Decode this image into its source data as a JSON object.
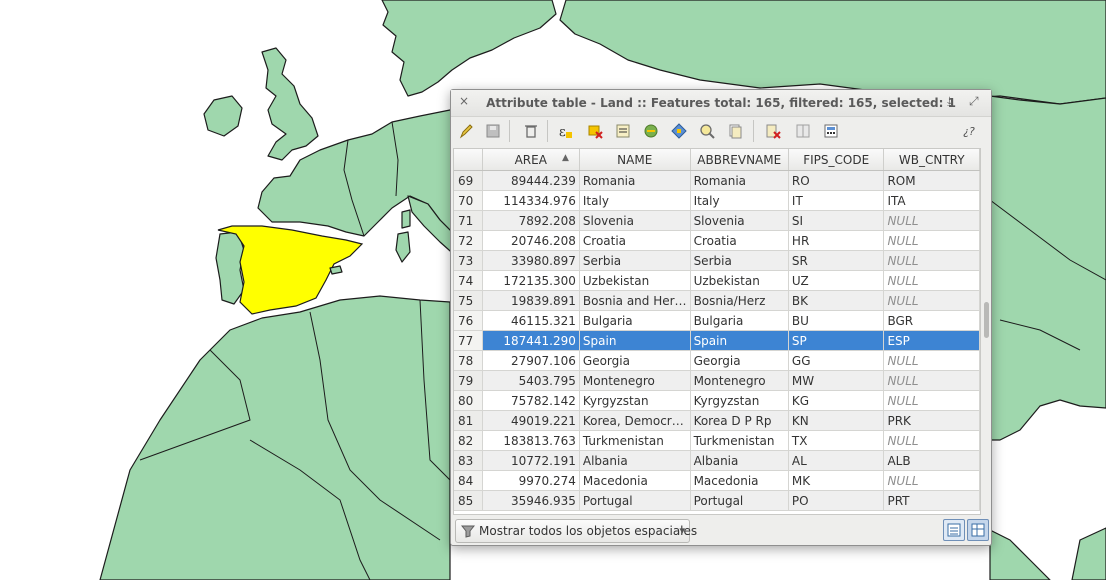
{
  "window": {
    "title": "Attribute table - Land :: Features total: 165, filtered: 165, selected: 1"
  },
  "icons": {
    "close": "×",
    "dock": "⤓",
    "maximize": "⤢",
    "help": "¿?"
  },
  "columns": [
    "AREA",
    "NAME",
    "ABBREVNAME",
    "FIPS_CODE",
    "WB_CNTRY"
  ],
  "sort_indicator": "▲",
  "rows": [
    {
      "id": "69",
      "area": "89444.239",
      "name": "Romania",
      "abbrev": "Romania",
      "fips": "RO",
      "wb": "ROM"
    },
    {
      "id": "70",
      "area": "114334.976",
      "name": "Italy",
      "abbrev": "Italy",
      "fips": "IT",
      "wb": "ITA"
    },
    {
      "id": "71",
      "area": "7892.208",
      "name": "Slovenia",
      "abbrev": "Slovenia",
      "fips": "SI",
      "wb": "NULL"
    },
    {
      "id": "72",
      "area": "20746.208",
      "name": "Croatia",
      "abbrev": "Croatia",
      "fips": "HR",
      "wb": "NULL"
    },
    {
      "id": "73",
      "area": "33980.897",
      "name": "Serbia",
      "abbrev": "Serbia",
      "fips": "SR",
      "wb": "NULL"
    },
    {
      "id": "74",
      "area": "172135.300",
      "name": "Uzbekistan",
      "abbrev": "Uzbekistan",
      "fips": "UZ",
      "wb": "NULL"
    },
    {
      "id": "75",
      "area": "19839.891",
      "name": "Bosnia and Her…",
      "abbrev": "Bosnia/Herz",
      "fips": "BK",
      "wb": "NULL"
    },
    {
      "id": "76",
      "area": "46115.321",
      "name": "Bulgaria",
      "abbrev": "Bulgaria",
      "fips": "BU",
      "wb": "BGR"
    },
    {
      "id": "77",
      "area": "187441.290",
      "name": "Spain",
      "abbrev": "Spain",
      "fips": "SP",
      "wb": "ESP",
      "selected": true
    },
    {
      "id": "78",
      "area": "27907.106",
      "name": "Georgia",
      "abbrev": "Georgia",
      "fips": "GG",
      "wb": "NULL"
    },
    {
      "id": "79",
      "area": "5403.795",
      "name": "Montenegro",
      "abbrev": "Montenegro",
      "fips": "MW",
      "wb": "NULL"
    },
    {
      "id": "80",
      "area": "75782.142",
      "name": "Kyrgyzstan",
      "abbrev": "Kyrgyzstan",
      "fips": "KG",
      "wb": "NULL"
    },
    {
      "id": "81",
      "area": "49019.221",
      "name": "Korea, Democr…",
      "abbrev": "Korea D P Rp",
      "fips": "KN",
      "wb": "PRK"
    },
    {
      "id": "82",
      "area": "183813.763",
      "name": "Turkmenistan",
      "abbrev": "Turkmenistan",
      "fips": "TX",
      "wb": "NULL"
    },
    {
      "id": "83",
      "area": "10772.191",
      "name": "Albania",
      "abbrev": "Albania",
      "fips": "AL",
      "wb": "ALB"
    },
    {
      "id": "84",
      "area": "9970.274",
      "name": "Macedonia",
      "abbrev": "Macedonia",
      "fips": "MK",
      "wb": "NULL"
    },
    {
      "id": "85",
      "area": "35946.935",
      "name": "Portugal",
      "abbrev": "Portugal",
      "fips": "PO",
      "wb": "PRT"
    }
  ],
  "footer": {
    "filter_label": "Mostrar todos los objetos espaciales",
    "filter_arrow": "▾"
  },
  "colors": {
    "land": "#9fd7ad",
    "selected_feature": "#ffff00",
    "selected_row": "#3d84d3"
  }
}
